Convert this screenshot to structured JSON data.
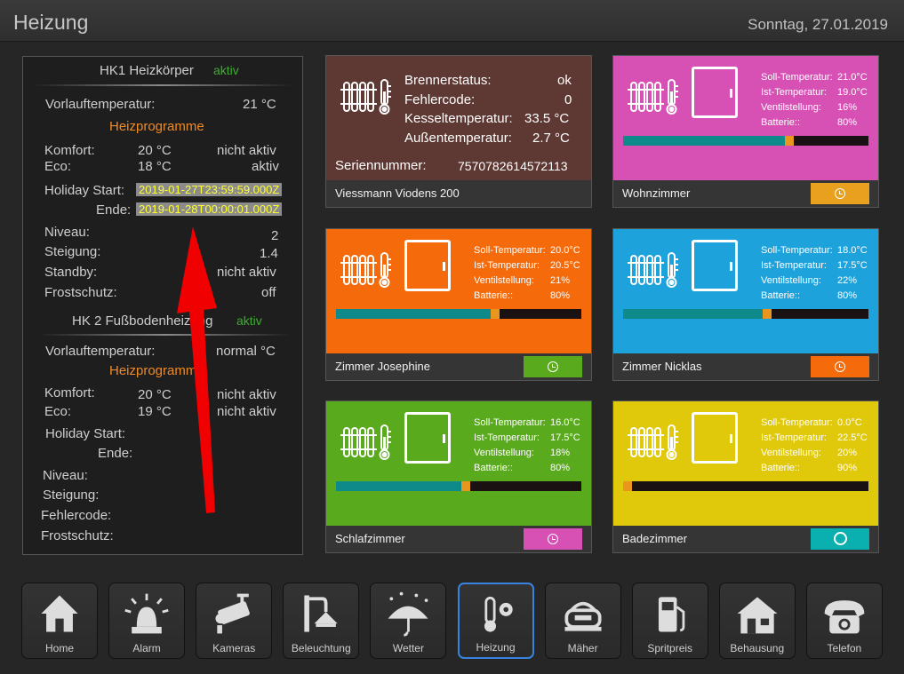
{
  "header": {
    "title": "Heizung",
    "date": "Sonntag, 27.01.2019"
  },
  "left_panel": {
    "hk1": {
      "title": "HK1 Heizkörper",
      "status": "aktiv",
      "vorlauf_label": "Vorlauftemperatur:",
      "vorlauf_value": "21 °C",
      "programme": "Heizprogramme",
      "komfort_label": "Komfort:",
      "komfort_temp": "20 °C",
      "komfort_state": "nicht aktiv",
      "eco_label": "Eco:",
      "eco_temp": "18 °C",
      "eco_state": "aktiv",
      "holiday_start_label": "Holiday Start:",
      "holiday_start_value": "2019-01-27T23:59:59.000Z",
      "ende_label": "Ende:",
      "ende_value": "2019-01-28T00:00:01.000Z",
      "niveau_label": "Niveau:",
      "niveau_value": "2",
      "steigung_label": "Steigung:",
      "steigung_value": "1.4",
      "standby_label": "Standby:",
      "standby_value": "nicht aktiv",
      "frost_label": "Frostschutz:",
      "frost_value": "off"
    },
    "hk2": {
      "title": "HK 2 Fußbodenheizung",
      "status": "aktiv",
      "vorlauf_label": "Vorlauftemperatur:",
      "vorlauf_value": "normal °C",
      "programme": "Heizprogramme",
      "komfort_label": "Komfort:",
      "komfort_temp": "20 °C",
      "komfort_state": "nicht aktiv",
      "eco_label": "Eco:",
      "eco_temp": "19 °C",
      "eco_state": "nicht aktiv",
      "holiday_start_label": "Holiday Start:",
      "ende_label": "Ende:",
      "niveau_label": "Niveau:",
      "steigung_label": "Steigung:",
      "fehler_label": "Fehlercode:",
      "frost_label": "Frostschutz:"
    }
  },
  "boiler": {
    "brenner_label": "Brennerstatus:",
    "brenner_value": "ok",
    "fehler_label": "Fehlercode:",
    "fehler_value": "0",
    "kessel_label": "Kesseltemperatur:",
    "kessel_value": "33.5 °C",
    "aussen_label": "Außentemperatur:",
    "aussen_value": "2.7 °C",
    "serial_label": "Seriennummer:",
    "serial_value": "7570782614572113",
    "name": "Viessmann Viodens 200",
    "color": "#5e3832"
  },
  "labels": {
    "soll": "Soll-Temperatur:",
    "ist": "Ist-Temperatur:",
    "ventil": "Ventilstellung:",
    "batt": "Batterie::"
  },
  "rooms": [
    {
      "name": "Wohnzimmer",
      "soll": "21.0°C",
      "ist": "19.0°C",
      "ventil": "16%",
      "batt": "80%",
      "valve": 0.66,
      "color": "#d750b4",
      "btn_color": "#e8a01e",
      "btn_icon": "clock-icon"
    },
    {
      "name": "Zimmer Josephine",
      "soll": "20.0°C",
      "ist": "20.5°C",
      "ventil": "21%",
      "batt": "80%",
      "valve": 0.63,
      "color": "#f56a0a",
      "btn_color": "#5aaa1e",
      "btn_icon": "clock-icon"
    },
    {
      "name": "Zimmer Nicklas",
      "soll": "18.0°C",
      "ist": "17.5°C",
      "ventil": "22%",
      "batt": "80%",
      "valve": 0.57,
      "color": "#1ea2dc",
      "btn_color": "#f56a0a",
      "btn_icon": "clock-icon"
    },
    {
      "name": "Schlafzimmer",
      "soll": "16.0°C",
      "ist": "17.5°C",
      "ventil": "18%",
      "batt": "80%",
      "valve": 0.51,
      "color": "#5aaa1e",
      "btn_color": "#d750b4",
      "btn_icon": "clock-icon"
    },
    {
      "name": "Badezimmer",
      "soll": "0.0°C",
      "ist": "22.5°C",
      "ventil": "20%",
      "batt": "90%",
      "valve": 0.0,
      "color": "#e0c80a",
      "btn_color": "#0ab0b0",
      "btn_icon": "ring-icon"
    }
  ],
  "nav": [
    {
      "label": "Home",
      "icon": "home-icon"
    },
    {
      "label": "Alarm",
      "icon": "alarm-icon"
    },
    {
      "label": "Kameras",
      "icon": "camera-icon"
    },
    {
      "label": "Beleuchtung",
      "icon": "lamp-icon"
    },
    {
      "label": "Wetter",
      "icon": "umbrella-icon"
    },
    {
      "label": "Heizung",
      "icon": "thermostat-icon",
      "selected": true
    },
    {
      "label": "Mäher",
      "icon": "mower-icon"
    },
    {
      "label": "Spritpreis",
      "icon": "fuel-icon"
    },
    {
      "label": "Behausung",
      "icon": "house-icon"
    },
    {
      "label": "Telefon",
      "icon": "phone-icon"
    }
  ]
}
